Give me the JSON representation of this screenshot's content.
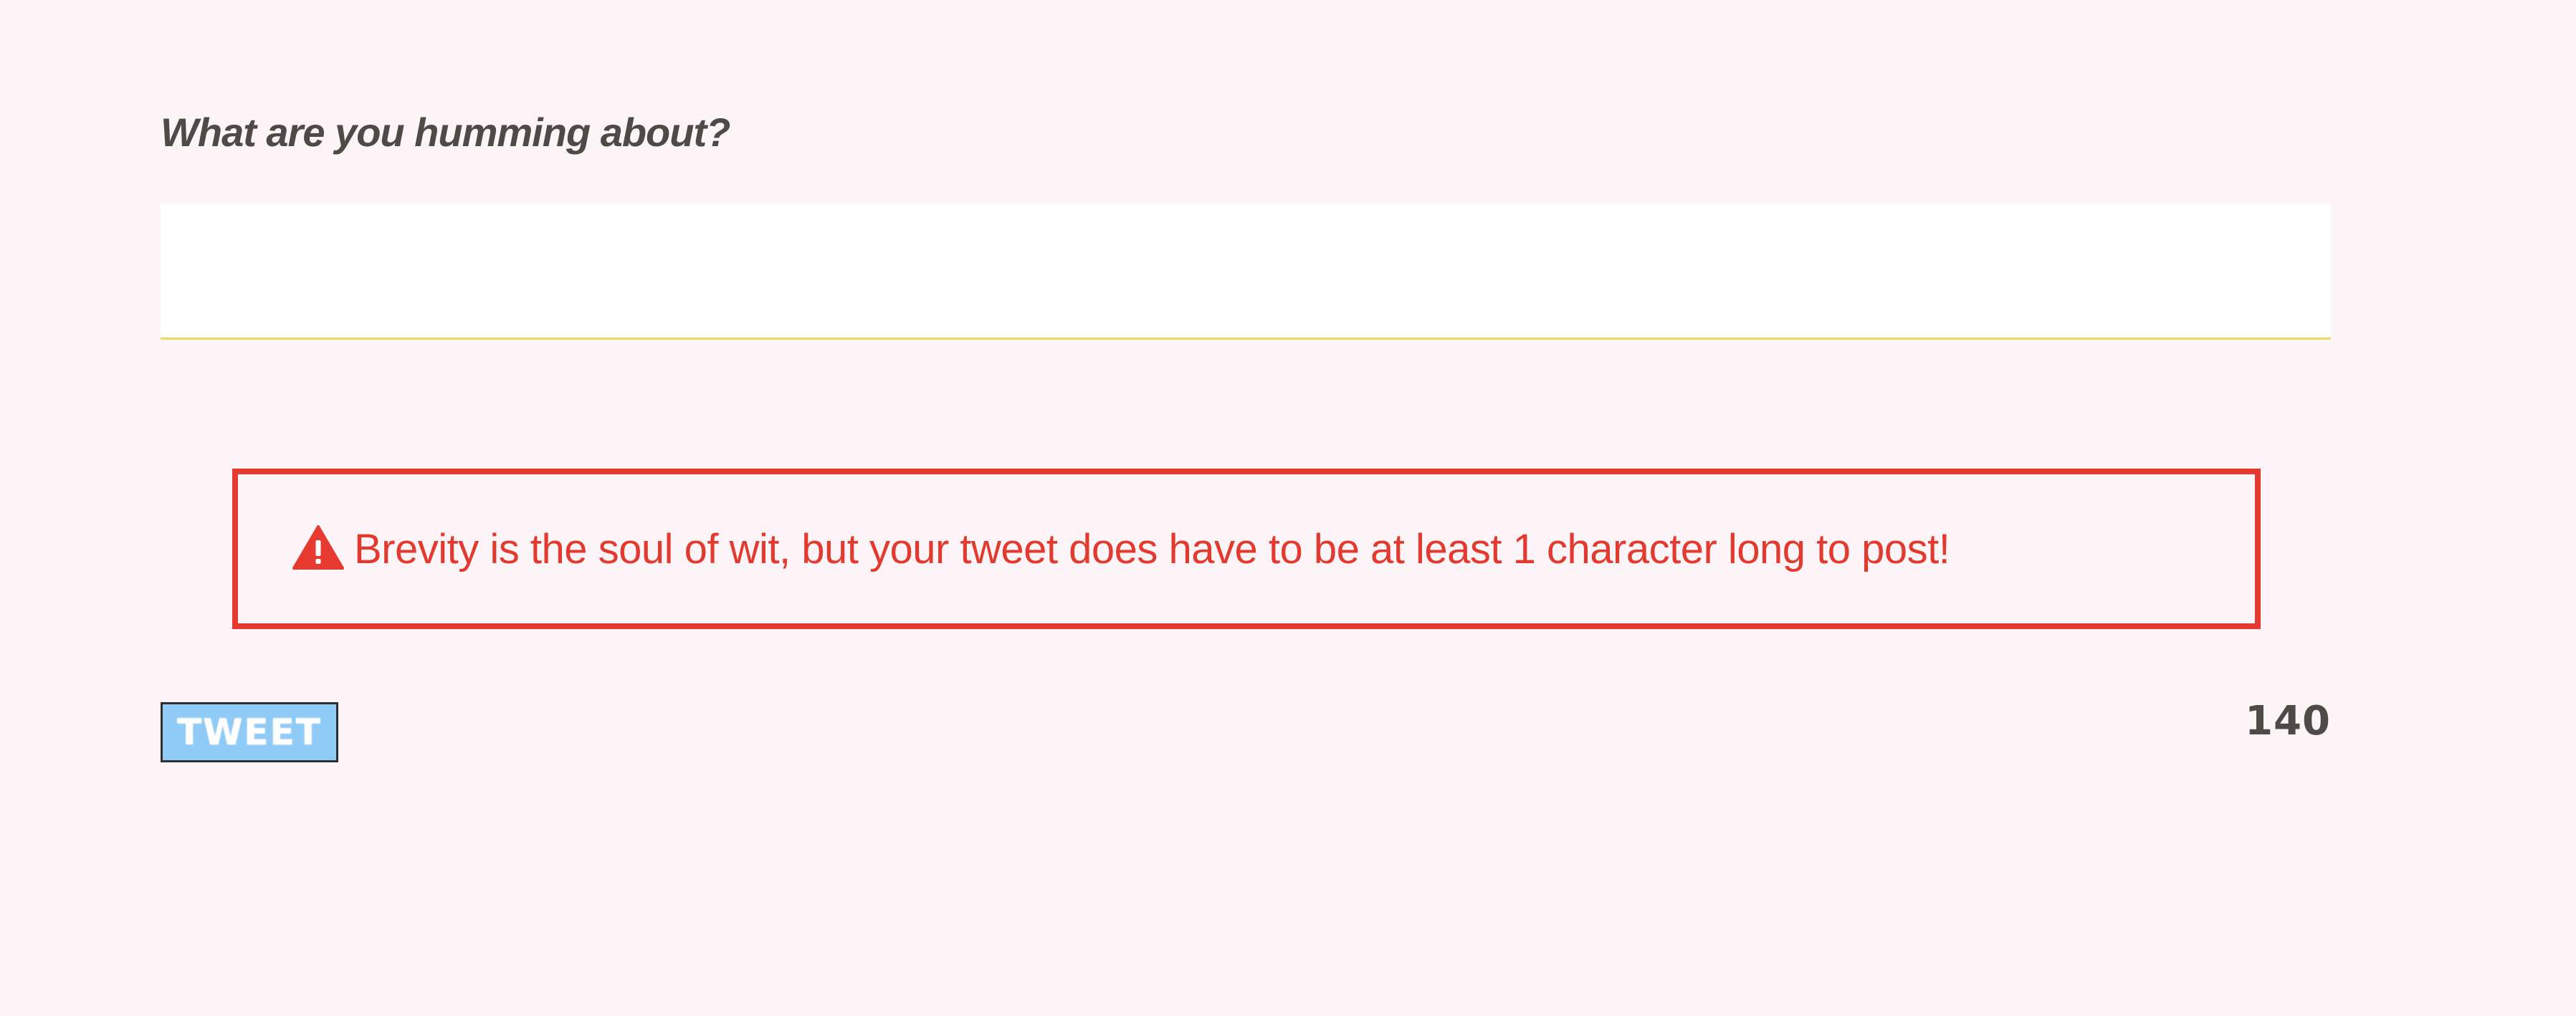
{
  "compose": {
    "prompt": "What are you humming about?",
    "input_value": "",
    "input_placeholder": ""
  },
  "error": {
    "icon": "warning-icon",
    "message": "Brevity is the soul of wit, but your tweet does have to be at least 1 character long to post!"
  },
  "footer": {
    "tweet_button_label": "TWEET",
    "char_count": "140"
  },
  "colors": {
    "background": "#fcf4f6",
    "error": "#e63a30",
    "input_underline": "#f0d95a",
    "button": "#8fcbf6",
    "text_dark": "#4e4b47"
  }
}
